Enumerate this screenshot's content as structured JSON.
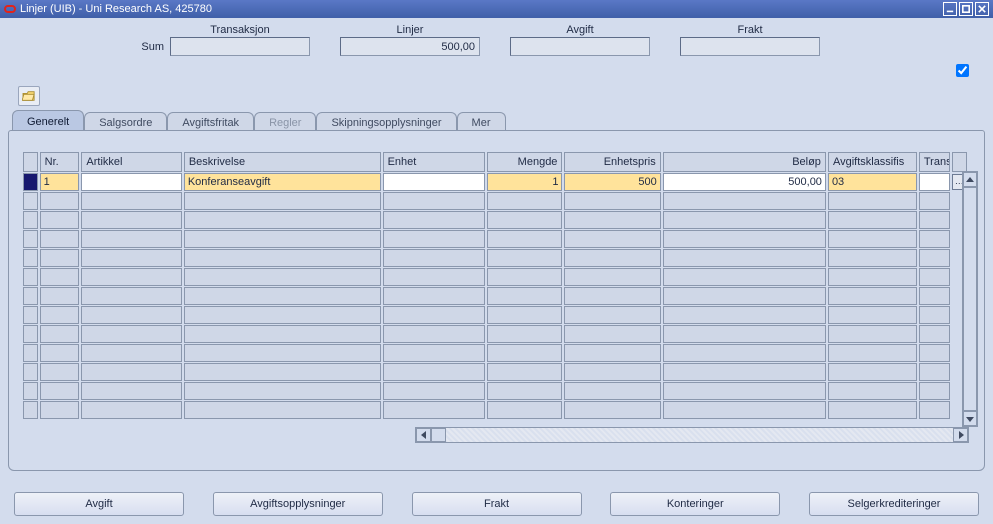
{
  "window": {
    "title": "Linjer (UIB) - Uni Research AS, 425780"
  },
  "summary": {
    "sum_label": "Sum",
    "groups": {
      "transaksjon": {
        "label": "Transaksjon",
        "value": ""
      },
      "linjer": {
        "label": "Linjer",
        "value": "500,00"
      },
      "avgift": {
        "label": "Avgift",
        "value": ""
      },
      "frakt": {
        "label": "Frakt",
        "value": ""
      }
    },
    "top_checked": true
  },
  "tabs": {
    "generelt": "Generelt",
    "salgsordre": "Salgsordre",
    "avgiftsfritak": "Avgiftsfritak",
    "regler": "Regler",
    "skipning": "Skipningsopplysninger",
    "mer": "Mer"
  },
  "grid": {
    "headers": {
      "nr": "Nr.",
      "artikkel": "Artikkel",
      "beskrivelse": "Beskrivelse",
      "enhet": "Enhet",
      "mengde": "Mengde",
      "enhetspris": "Enhetspris",
      "belop": "Beløp",
      "avgift": "Avgiftsklassifis",
      "trans": "Trans."
    },
    "rows": [
      {
        "nr": "1",
        "artikkel": "",
        "beskrivelse": "Konferanseavgift",
        "enhet": "",
        "mengde": "1",
        "enhetspris": "500",
        "belop": "500,00",
        "avgift": "03",
        "trans": ""
      }
    ],
    "empty_row_count": 12
  },
  "buttons": {
    "avgift": "Avgift",
    "avgiftsopplysninger": "Avgiftsopplysninger",
    "frakt": "Frakt",
    "konteringer": "Konteringer",
    "selgerkrediteringer": "Selgerkrediteringer"
  },
  "icons": {
    "lov": "…"
  }
}
